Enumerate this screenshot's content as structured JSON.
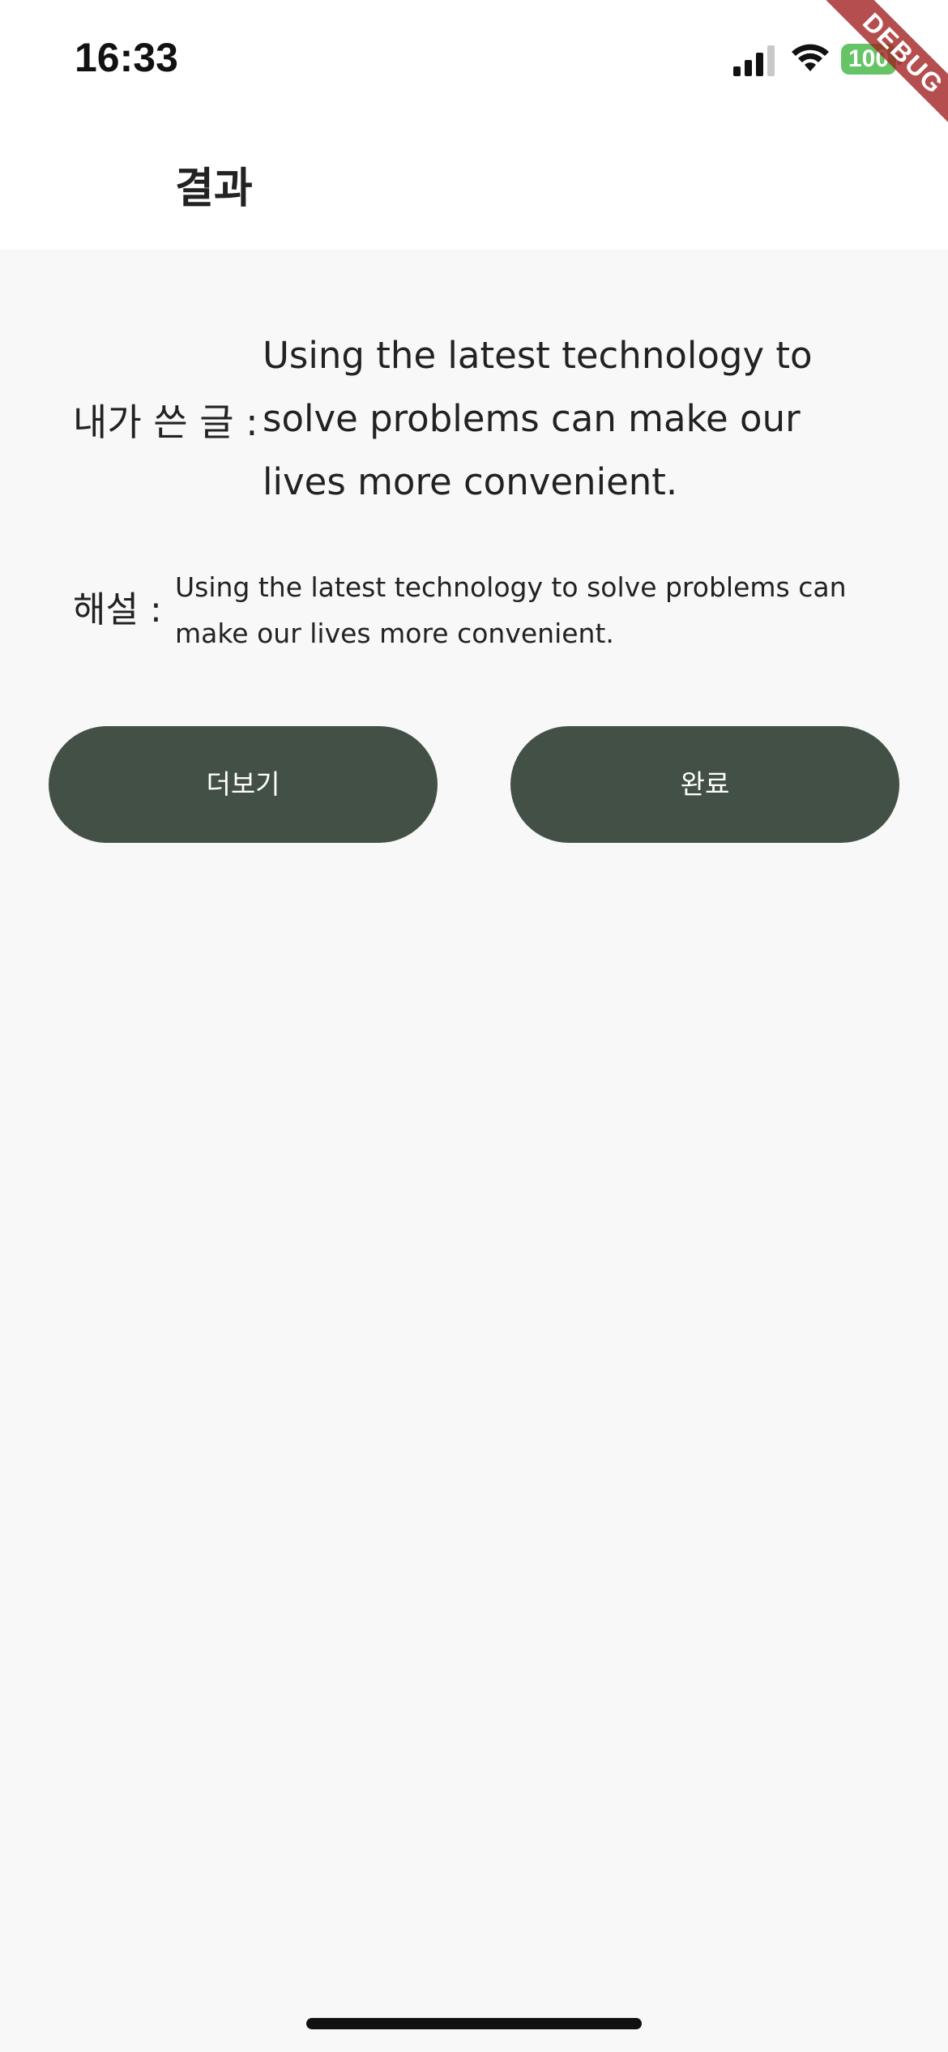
{
  "status_bar": {
    "time": "16:33",
    "battery": "100",
    "icons": [
      "signal-icon",
      "wifi-icon",
      "battery-icon"
    ],
    "battery_color": "#65c466"
  },
  "debug_banner": {
    "label": "DEBUG"
  },
  "app_bar": {
    "title": "결과"
  },
  "result": {
    "my_writing_label": "내가 쓴 글 :",
    "my_writing_text": "Using the latest technology to solve problems can make our lives more convenient.",
    "explanation_label": "해설 :",
    "explanation_text": "Using the latest technology to solve problems can make our lives more convenient."
  },
  "buttons": {
    "more_label": "더보기",
    "done_label": "완료",
    "color": "#435046"
  }
}
